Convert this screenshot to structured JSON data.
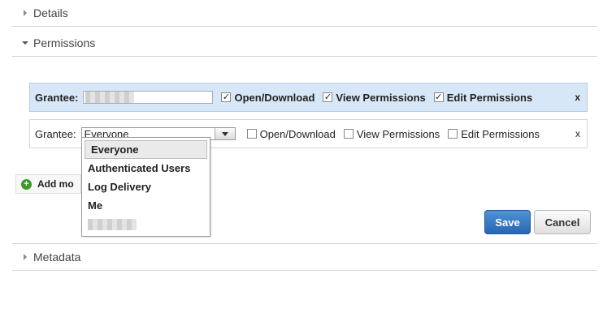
{
  "sections": {
    "details": "Details",
    "permissions": "Permissions",
    "metadata": "Metadata"
  },
  "rows": [
    {
      "grantee_label": "Grantee:",
      "perms": [
        {
          "label": "Open/Download",
          "checked": true
        },
        {
          "label": "View Permissions",
          "checked": true
        },
        {
          "label": "Edit Permissions",
          "checked": true
        }
      ],
      "remove": "x"
    },
    {
      "grantee_label": "Grantee:",
      "grantee_value": "Everyone",
      "perms": [
        {
          "label": "Open/Download",
          "checked": false
        },
        {
          "label": "View Permissions",
          "checked": false
        },
        {
          "label": "Edit Permissions",
          "checked": false
        }
      ],
      "remove": "x"
    }
  ],
  "dropdown": {
    "options": [
      "Everyone",
      "Authenticated Users",
      "Log Delivery",
      "Me"
    ],
    "selected": "Everyone"
  },
  "add_more": "Add mo",
  "buttons": {
    "save": "Save",
    "cancel": "Cancel"
  },
  "colors": {
    "save_bg": "#2f74c3",
    "selected_row_bg": "#d8e7f7",
    "add_icon": "#3b9a2a"
  }
}
